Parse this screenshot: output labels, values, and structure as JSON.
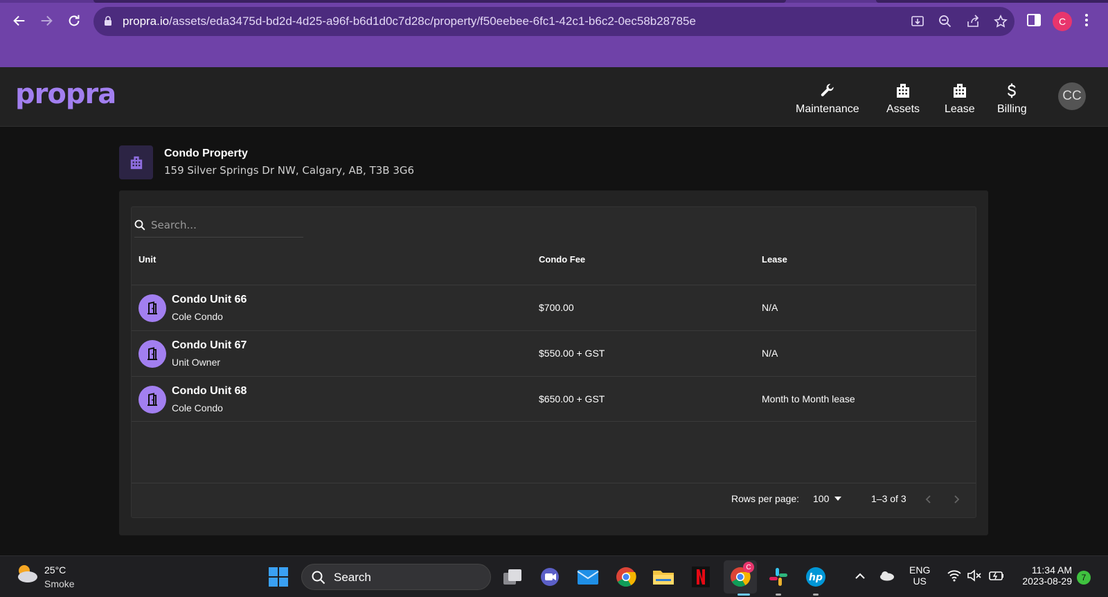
{
  "browser": {
    "url_domain": "propra.io",
    "url_path": "/assets/eda3475d-bd2d-4d25-a96f-b6d1d0c7d28c/property/f50eebee-6fc1-42c1-b6c2-0ec58b28785e",
    "profile_initial": "C"
  },
  "header": {
    "logo": "propra",
    "nav": [
      {
        "label": "Maintenance",
        "icon": "wrench-icon"
      },
      {
        "label": "Assets",
        "icon": "building-icon"
      },
      {
        "label": "Lease",
        "icon": "building-icon"
      },
      {
        "label": "Billing",
        "icon": "dollar-icon"
      }
    ],
    "avatar_initials": "CC"
  },
  "property": {
    "title": "Condo Property",
    "address": "159 Silver Springs Dr NW, Calgary, AB, T3B 3G6"
  },
  "table": {
    "search_placeholder": "Search...",
    "columns": [
      "Unit",
      "Condo Fee",
      "Lease"
    ],
    "rows": [
      {
        "unit": "Condo Unit 66",
        "owner": "Cole Condo",
        "fee": "$700.00",
        "lease": "N/A"
      },
      {
        "unit": "Condo Unit 67",
        "owner": "Unit Owner",
        "fee": "$550.00 + GST",
        "lease": "N/A"
      },
      {
        "unit": "Condo Unit 68",
        "owner": "Cole Condo",
        "fee": "$650.00 + GST",
        "lease": "Month to Month lease"
      }
    ],
    "pagination": {
      "rows_label": "Rows per page:",
      "rows_value": "100",
      "range": "1–3 of 3"
    }
  },
  "taskbar": {
    "temperature": "25°C",
    "condition": "Smoke",
    "search_label": "Search",
    "chrome_badge": "C",
    "lang_top": "ENG",
    "lang_bottom": "US",
    "time": "11:34 AM",
    "date": "2023-08-29",
    "notification_count": "7"
  },
  "colors": {
    "browser_frame": "#6f42a8",
    "accent": "#a27ff0",
    "app_header": "#222222",
    "background": "#121212"
  }
}
